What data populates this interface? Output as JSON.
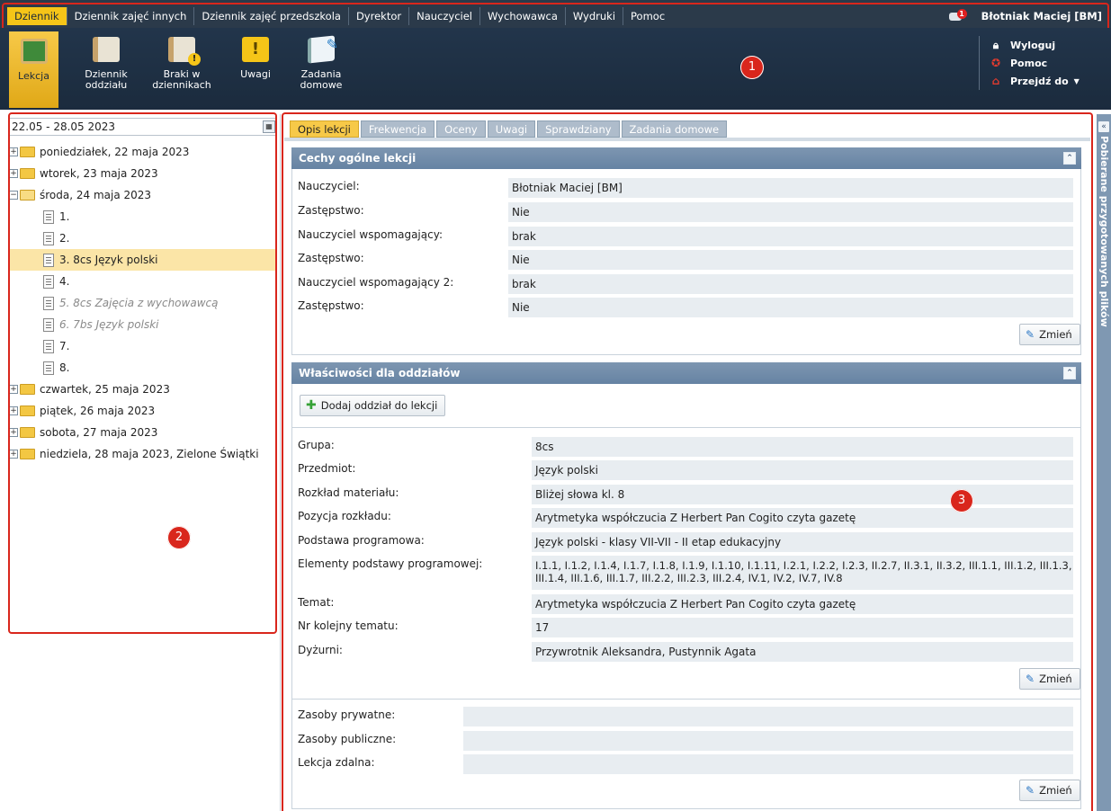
{
  "menu": {
    "items": [
      {
        "label": "Dziennik",
        "active": true
      },
      {
        "label": "Dziennik zajęć innych",
        "active": false
      },
      {
        "label": "Dziennik zajęć przedszkola",
        "active": false
      },
      {
        "label": "Dyrektor",
        "active": false
      },
      {
        "label": "Nauczyciel",
        "active": false
      },
      {
        "label": "Wychowawca",
        "active": false
      },
      {
        "label": "Wydruki",
        "active": false
      },
      {
        "label": "Pomoc",
        "active": false
      }
    ],
    "message_badge": "1",
    "user": "Błotniak Maciej [BM]"
  },
  "toolbar": {
    "tools": [
      {
        "label": "Lekcja",
        "icon": "blackboard-icon"
      },
      {
        "label": "Dziennik oddziału",
        "icon": "book-icon"
      },
      {
        "label": "Braki w dziennikach",
        "icon": "book-warning-icon"
      },
      {
        "label": "Uwagi",
        "icon": "warning-note-icon"
      },
      {
        "label": "Zadania domowe",
        "icon": "homework-icon"
      }
    ],
    "links": [
      {
        "label": "Wyloguj",
        "icon": "lock-icon"
      },
      {
        "label": "Pomoc",
        "icon": "lifebuoy-icon"
      },
      {
        "label": "Przejdź do",
        "icon": "home-icon"
      }
    ]
  },
  "callouts": [
    "1",
    "2",
    "3"
  ],
  "left": {
    "date_range": "22.05 - 28.05 2023",
    "tree": [
      {
        "label": "poniedziałek, 22 maja 2023",
        "type": "day"
      },
      {
        "label": "wtorek, 23 maja 2023",
        "type": "day"
      },
      {
        "label": "środa, 24 maja 2023",
        "type": "day-open"
      },
      {
        "label": "1.",
        "type": "lesson"
      },
      {
        "label": "2.",
        "type": "lesson"
      },
      {
        "label": "3. 8cs Język polski",
        "type": "lesson-selected"
      },
      {
        "label": "4.",
        "type": "lesson"
      },
      {
        "label": "5. 8cs Zajęcia z wychowawcą",
        "type": "lesson-muted"
      },
      {
        "label": "6. 7bs Język polski",
        "type": "lesson-muted"
      },
      {
        "label": "7.",
        "type": "lesson"
      },
      {
        "label": "8.",
        "type": "lesson"
      },
      {
        "label": "czwartek, 25 maja 2023",
        "type": "day"
      },
      {
        "label": "piątek, 26 maja 2023",
        "type": "day"
      },
      {
        "label": "sobota, 27 maja 2023",
        "type": "day"
      },
      {
        "label": "niedziela, 28 maja 2023, Zielone Świątki",
        "type": "day"
      }
    ]
  },
  "tabs": [
    "Opis lekcji",
    "Frekwencja",
    "Oceny",
    "Uwagi",
    "Sprawdziany",
    "Zadania domowe"
  ],
  "general": {
    "title": "Cechy ogólne lekcji",
    "rows": [
      {
        "label": "Nauczyciel:",
        "value": "Błotniak Maciej [BM]"
      },
      {
        "label": "Zastępstwo:",
        "value": "Nie"
      },
      {
        "label": "Nauczyciel wspomagający:",
        "value": "brak"
      },
      {
        "label": "Zastępstwo:",
        "value": "Nie"
      },
      {
        "label": "Nauczyciel wspomagający 2:",
        "value": "brak"
      },
      {
        "label": "Zastępstwo:",
        "value": "Nie"
      }
    ],
    "change_label": "Zmień"
  },
  "branches": {
    "title": "Właściwości dla oddziałów",
    "add_label": "Dodaj oddział do lekcji",
    "rows": [
      {
        "label": "Grupa:",
        "value": "8cs"
      },
      {
        "label": "Przedmiot:",
        "value": "Język polski"
      },
      {
        "label": "Rozkład materiału:",
        "value": "Bliżej słowa kl. 8"
      },
      {
        "label": "Pozycja rozkładu:",
        "value": "Arytmetyka współczucia Z Herbert Pan Cogito czyta gazetę"
      },
      {
        "label": "Podstawa programowa:",
        "value": "Język polski - klasy VII-VII - II etap edukacyjny"
      },
      {
        "label": "Elementy podstawy programowej:",
        "value": "I.1.1, I.1.2, I.1.4, I.1.7, I.1.8, I.1.9, I.1.10, I.1.11, I.2.1, I.2.2, I.2.3, II.2.7, II.3.1, II.3.2, III.1.1, III.1.2, III.1.3, III.1.4, III.1.6, III.1.7, III.2.2, III.2.3, III.2.4, IV.1, IV.2, IV.7, IV.8"
      },
      {
        "label": "Temat:",
        "value": "Arytmetyka współczucia Z Herbert Pan Cogito czyta gazetę"
      },
      {
        "label": "Nr kolejny tematu:",
        "value": "17"
      },
      {
        "label": "Dyżurni:",
        "value": "Przywrotnik Aleksandra, Pustynnik Agata"
      }
    ],
    "change_label": "Zmień"
  },
  "resources": {
    "rows": [
      {
        "label": "Zasoby prywatne:",
        "value": ""
      },
      {
        "label": "Zasoby publiczne:",
        "value": ""
      },
      {
        "label": "Lekcja zdalna:",
        "value": ""
      }
    ],
    "change_label": "Zmień"
  },
  "right_panel": {
    "label": "Pobierane przygotowanych plików"
  },
  "colors": {
    "accent": "#f5c518",
    "navy": "#22354b",
    "callout": "#d9261c"
  }
}
